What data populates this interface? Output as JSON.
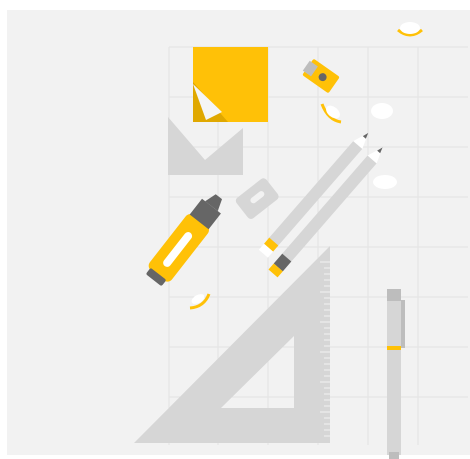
{
  "illustration": {
    "subject": "stationery-flatlay",
    "colors": {
      "background": "#f2f2f2",
      "grid": "#e3e3e3",
      "accent": "#ffc107",
      "accent_dark": "#e0a800",
      "light_gray": "#d6d6d6",
      "mid_gray": "#bdbdbd",
      "dark_gray": "#666666",
      "white": "#ffffff"
    },
    "icons": [
      "sticky-note-icon",
      "pencil-sharpener-icon",
      "envelope-icon",
      "highlighter-icon",
      "eraser-icon",
      "pencil-icon",
      "set-square-icon",
      "pen-icon",
      "shaving-icon"
    ]
  }
}
